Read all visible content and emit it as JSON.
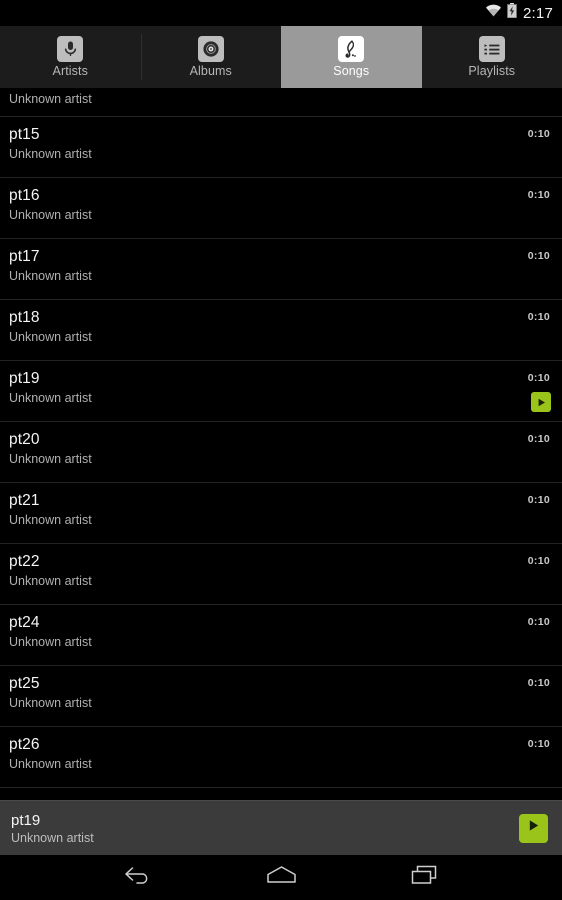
{
  "status_bar": {
    "time": "2:17",
    "wifi_icon": "wifi-icon",
    "battery_icon": "battery-charging-icon"
  },
  "tabs": [
    {
      "label": "Artists",
      "icon": "microphone-icon",
      "selected": false
    },
    {
      "label": "Albums",
      "icon": "disc-icon",
      "selected": false
    },
    {
      "label": "Songs",
      "icon": "music-note-icon",
      "selected": true
    },
    {
      "label": "Playlists",
      "icon": "list-icon",
      "selected": false
    }
  ],
  "song_list": {
    "partial_top_row": {
      "artist": "Unknown artist"
    },
    "rows": [
      {
        "title": "pt15",
        "artist": "Unknown artist",
        "duration": "0:10",
        "playing": false
      },
      {
        "title": "pt16",
        "artist": "Unknown artist",
        "duration": "0:10",
        "playing": false
      },
      {
        "title": "pt17",
        "artist": "Unknown artist",
        "duration": "0:10",
        "playing": false
      },
      {
        "title": "pt18",
        "artist": "Unknown artist",
        "duration": "0:10",
        "playing": false
      },
      {
        "title": "pt19",
        "artist": "Unknown artist",
        "duration": "0:10",
        "playing": true
      },
      {
        "title": "pt20",
        "artist": "Unknown artist",
        "duration": "0:10",
        "playing": false
      },
      {
        "title": "pt21",
        "artist": "Unknown artist",
        "duration": "0:10",
        "playing": false
      },
      {
        "title": "pt22",
        "artist": "Unknown artist",
        "duration": "0:10",
        "playing": false
      },
      {
        "title": "pt24",
        "artist": "Unknown artist",
        "duration": "0:10",
        "playing": false
      },
      {
        "title": "pt25",
        "artist": "Unknown artist",
        "duration": "0:10",
        "playing": false
      },
      {
        "title": "pt26",
        "artist": "Unknown artist",
        "duration": "0:10",
        "playing": false
      }
    ]
  },
  "now_playing": {
    "title": "pt19",
    "artist": "Unknown artist",
    "play_icon": "play-icon"
  },
  "nav_bar": {
    "back_icon": "back-arrow-icon",
    "home_icon": "home-icon",
    "recents_icon": "recent-apps-icon"
  },
  "colors": {
    "accent_green": "#9ac41a",
    "selected_tab_bg": "#9a9a9a",
    "now_playing_bg": "#3b3b3b",
    "list_bg": "#000000"
  }
}
